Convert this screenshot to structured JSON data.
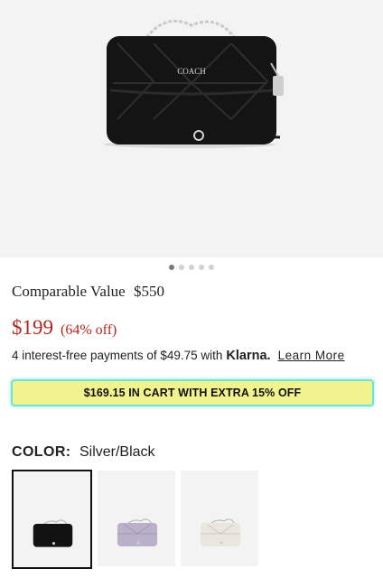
{
  "product": {
    "brand_mark": "COACH",
    "comparable_label": "Comparable Value",
    "comparable_value": "$550",
    "price": "$199",
    "discount": "(64% off)"
  },
  "klarna": {
    "text": "4 interest-free payments of $49.75 with",
    "brand": "Klarna.",
    "learn_more": "Learn More"
  },
  "promo": {
    "text": "$169.15 IN CART WITH EXTRA 15% OFF"
  },
  "color": {
    "label": "COLOR:",
    "selected": "Silver/Black",
    "swatches": [
      {
        "name": "Silver/Black",
        "bag_color": "#121212",
        "selected": true
      },
      {
        "name": "Lilac",
        "bag_color": "#b9b0c9",
        "selected": false
      },
      {
        "name": "Chalk",
        "bag_color": "#e9e6df",
        "selected": false
      }
    ]
  },
  "carousel": {
    "total": 5,
    "active": 1
  },
  "colors": {
    "price_red": "#b3261e",
    "promo_yellow": "#f1f38f",
    "promo_border": "#6fe3d7"
  }
}
